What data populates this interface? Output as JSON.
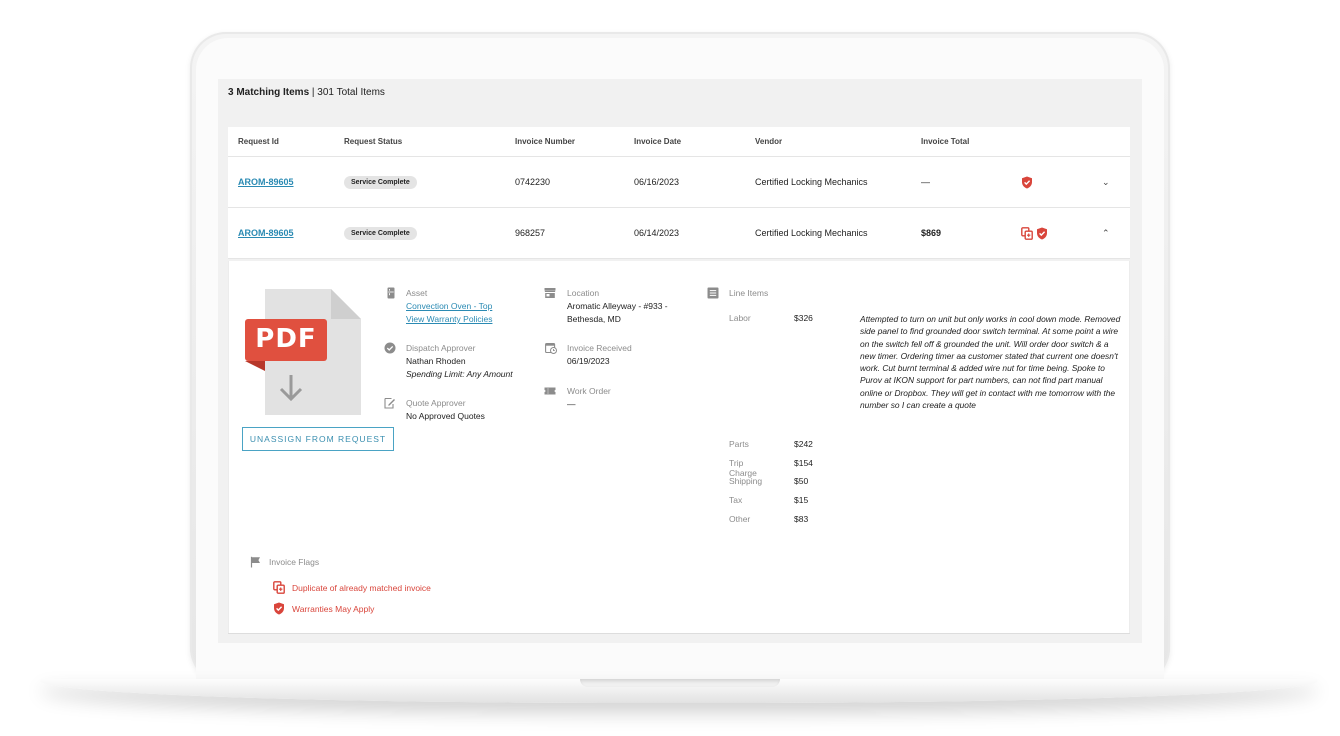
{
  "summary": {
    "matching": "3 Matching Items",
    "separator": " | ",
    "total": "301 Total Items"
  },
  "columns": [
    "Request Id",
    "Request Status",
    "Invoice Number",
    "Invoice Date",
    "Vendor",
    "Invoice Total"
  ],
  "rows": [
    {
      "request_id": "AROM-89605",
      "status": "Service Complete",
      "invoice_number": "0742230",
      "invoice_date": "06/16/2023",
      "vendor": "Certified Locking Mechanics",
      "total": "—",
      "flag_icons": [
        "shield-check-icon"
      ],
      "expanded": false
    },
    {
      "request_id": "AROM-89605",
      "status": "Service Complete",
      "invoice_number": "968257",
      "invoice_date": "06/14/2023",
      "vendor": "Certified Locking Mechanics",
      "total": "$869",
      "flag_icons": [
        "duplicate-icon",
        "shield-check-icon"
      ],
      "expanded": true
    }
  ],
  "detail": {
    "pdf_label": "PDF",
    "unassign_label": "UNASSIGN FROM REQUEST",
    "asset": {
      "label": "Asset",
      "link": "Convection Oven - Top",
      "warranty_link": "View Warranty Policies"
    },
    "dispatch": {
      "label": "Dispatch Approver",
      "name": "Nathan Rhoden",
      "limit": "Spending Limit: Any Amount"
    },
    "quote": {
      "label": "Quote Approver",
      "value": "No Approved Quotes"
    },
    "location": {
      "label": "Location",
      "line1": "Aromatic Alleyway - #933 -",
      "line2": "Bethesda, MD"
    },
    "received": {
      "label": "Invoice Received",
      "value": "06/19/2023"
    },
    "work_order": {
      "label": "Work Order",
      "value": "—"
    },
    "line_items": {
      "label": "Line Items",
      "labor": {
        "k": "Labor",
        "v": "$326"
      },
      "items": [
        {
          "k": "Parts",
          "v": "$242"
        },
        {
          "k": "Trip Charge",
          "v": "$154"
        },
        {
          "k": "Shipping",
          "v": "$50"
        },
        {
          "k": "Tax",
          "v": "$15"
        },
        {
          "k": "Other",
          "v": "$83"
        }
      ]
    },
    "note": "Attempted to turn on unit but only works in cool down mode. Removed side panel to find grounded door switch terminal. At some point a wire on the switch fell off & grounded the unit. Will order door switch & a new timer. Ordering timer aa customer stated that current one doesn't work. Cut burnt terminal & added wire nut for time being. Spoke to Purov at IKON support for part numbers, can not find part manual online or Dropbox. They will get in contact with me tomorrow with the number so I can create a quote",
    "flags": {
      "label": "Invoice Flags",
      "items": [
        "Duplicate of already matched invoice",
        "Warranties May Apply"
      ]
    }
  },
  "colors": {
    "accent": "#2a8ab3",
    "danger": "#d9453b",
    "pdf_red": "#e0503f"
  }
}
